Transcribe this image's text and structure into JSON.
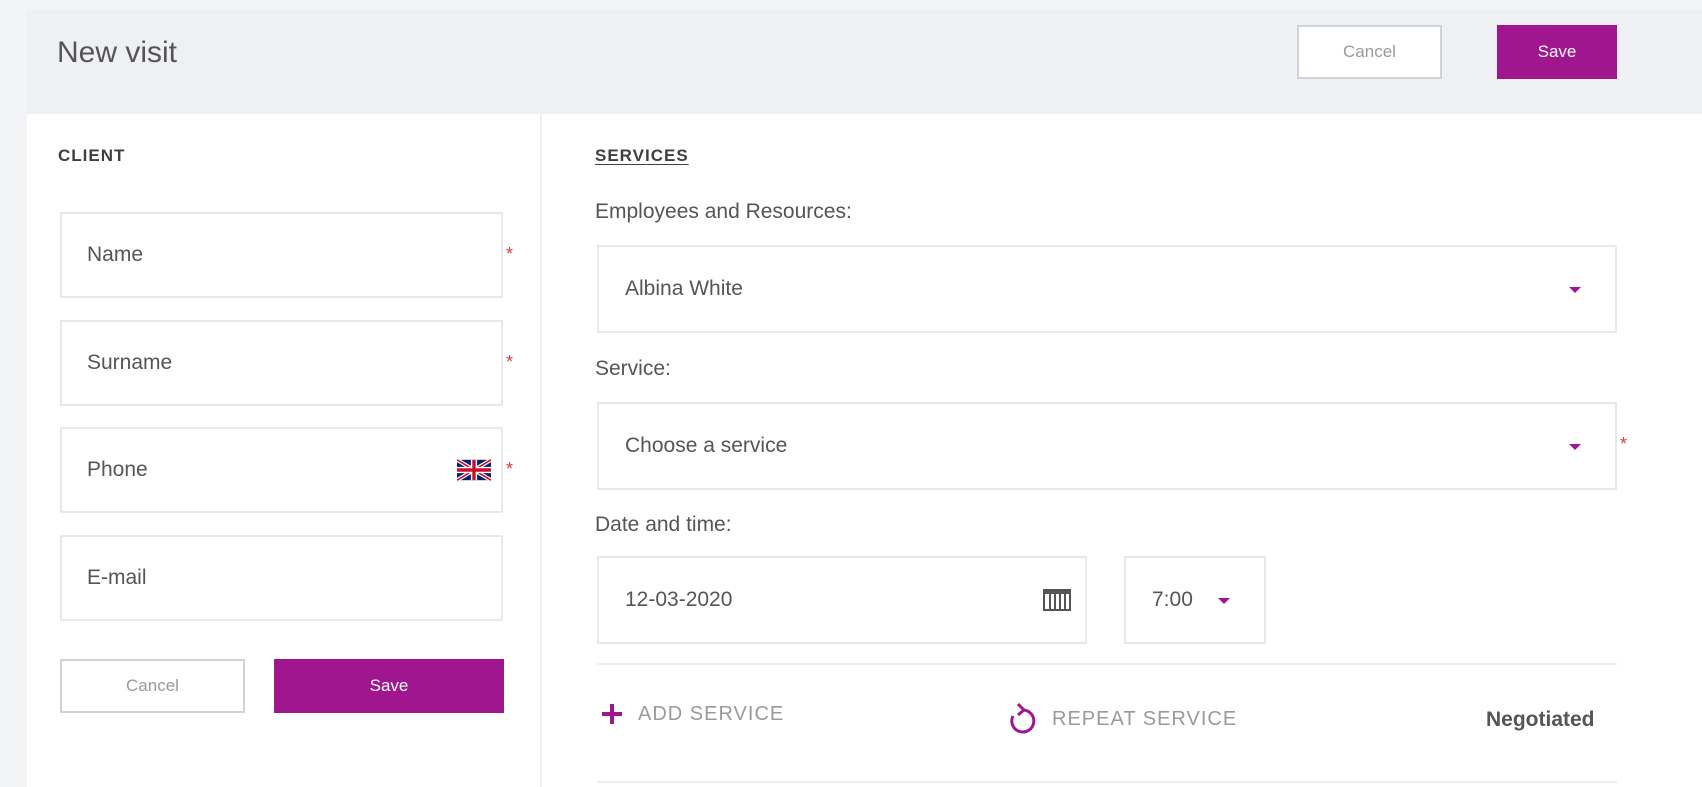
{
  "header": {
    "title": "New visit",
    "cancel_label": "Cancel",
    "save_label": "Save"
  },
  "client": {
    "section_label": "CLIENT",
    "fields": {
      "name": "Name",
      "surname": "Surname",
      "phone": "Phone",
      "email": "E-mail"
    },
    "cancel_label": "Cancel",
    "save_label": "Save"
  },
  "services": {
    "section_label": "SERVICES",
    "employees_label": "Employees and Resources:",
    "employee_value": "Albina White",
    "service_label": "Service:",
    "service_placeholder": "Choose a service",
    "datetime_label": "Date and time:",
    "date_value": "12-03-2020",
    "time_value": "7:00",
    "add_service_label": "ADD SERVICE",
    "repeat_service_label": "REPEAT SERVICE",
    "price_label": "Negotiated"
  },
  "icons": {
    "phone_flag": "uk-flag-icon",
    "calendar": "calendar-icon",
    "add": "plus-icon",
    "repeat": "repeat-icon",
    "caret": "caret-down-icon"
  },
  "colors": {
    "accent": "#a0168f",
    "required": "#e03a3a",
    "header_bg": "#eef0f3"
  }
}
